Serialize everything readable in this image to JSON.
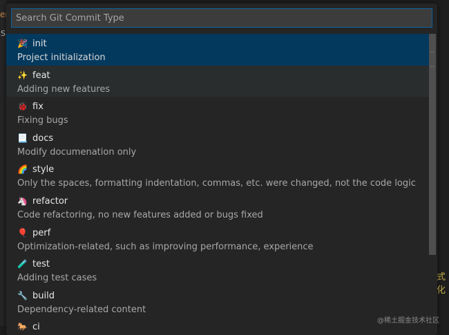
{
  "background": {
    "left_fragment_top": "er",
    "left_fragment_mid": "S",
    "right_fragment": "式化",
    "watermark": "@稀土掘金技术社区"
  },
  "quick_pick": {
    "search": {
      "placeholder": "Search Git Commit Type",
      "value": ""
    },
    "items": [
      {
        "emoji": "🎉",
        "label": "init",
        "description": "Project initialization",
        "state": "selected"
      },
      {
        "emoji": "✨",
        "label": "feat",
        "description": "Adding new features",
        "state": "hover"
      },
      {
        "emoji": "🐞",
        "label": "fix",
        "description": "Fixing bugs",
        "state": ""
      },
      {
        "emoji": "📃",
        "label": "docs",
        "description": "Modify documenation only",
        "state": ""
      },
      {
        "emoji": "🌈",
        "label": "style",
        "description": "Only the spaces, formatting indentation, commas, etc. were changed, not the code logic",
        "state": ""
      },
      {
        "emoji": "🦄",
        "label": "refactor",
        "description": "Code refactoring, no new features added or bugs fixed",
        "state": ""
      },
      {
        "emoji": "🎈",
        "label": "perf",
        "description": "Optimization-related, such as improving performance, experience",
        "state": ""
      },
      {
        "emoji": "🧪",
        "label": "test",
        "description": "Adding test cases",
        "state": ""
      },
      {
        "emoji": "🔧",
        "label": "build",
        "description": "Dependency-related content",
        "state": ""
      },
      {
        "emoji": "🐎",
        "label": "ci",
        "description": "",
        "state": ""
      }
    ]
  },
  "colors": {
    "selected_bg": "#04395e",
    "hover_bg": "#2a2d2e",
    "focus_border": "#0e639c"
  }
}
